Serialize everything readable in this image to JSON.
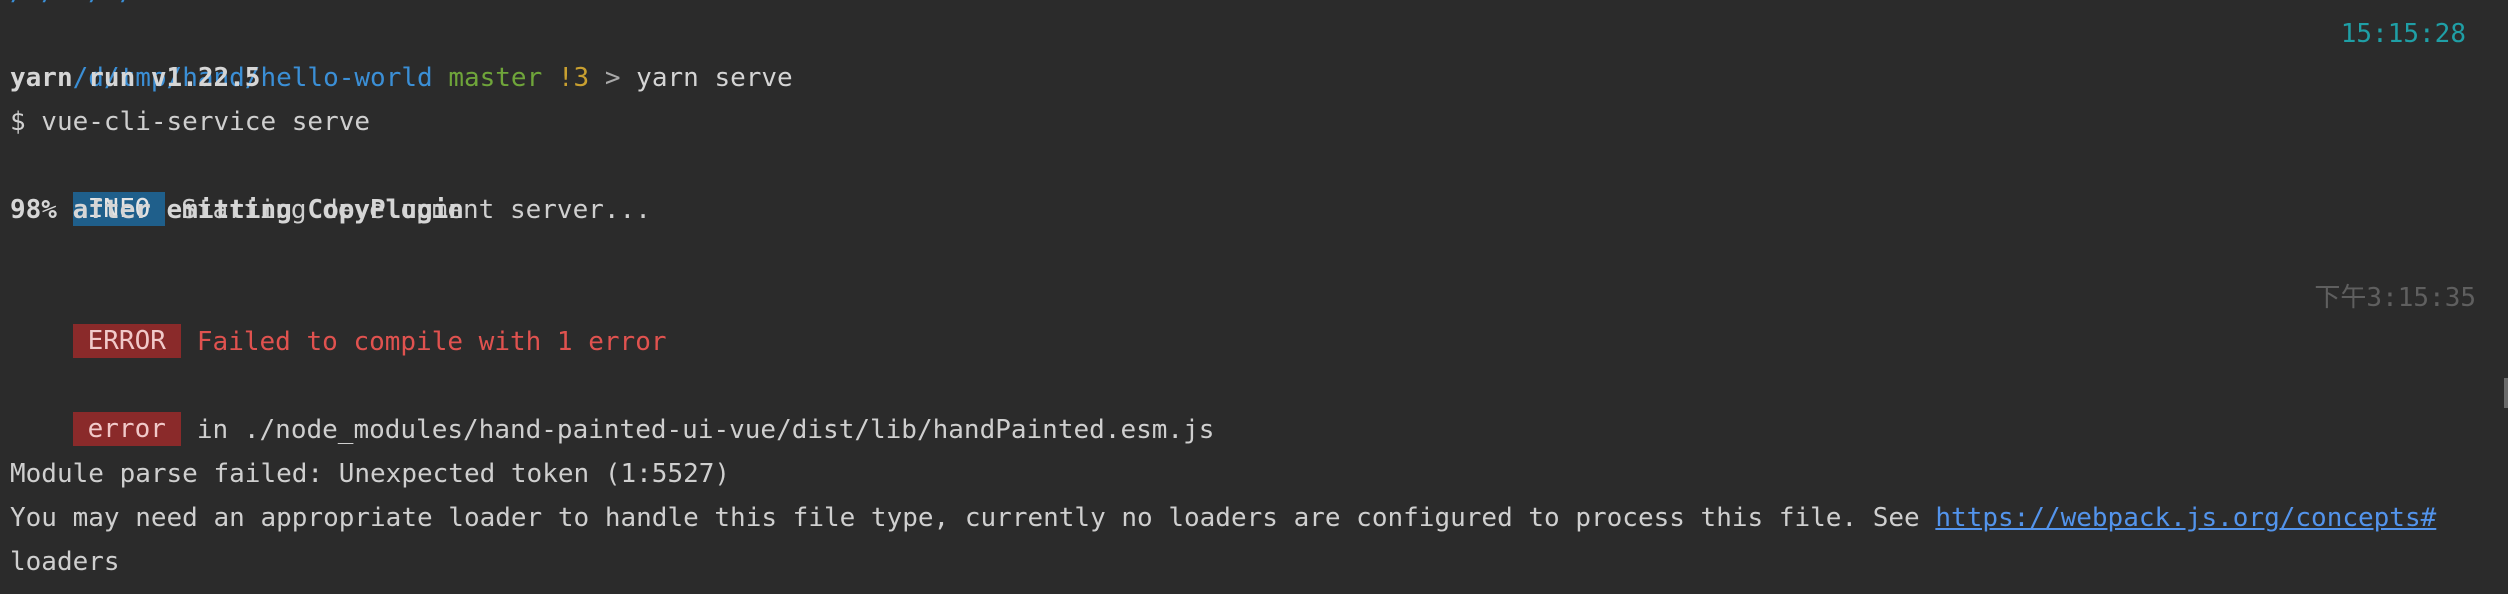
{
  "terminal": {
    "partial_line": "/ /  / / ",
    "prompt_line": {
      "path": "/d/tmp/hand/hello-world",
      "branch": "master",
      "status": "!3",
      "symbol": ">",
      "command": "yarn serve",
      "time": "15:15:28"
    },
    "yarn_version": "yarn run v1.22.5",
    "script_line": "$ vue-cli-service serve",
    "info": {
      "badge": "INFO",
      "text": "Starting development server..."
    },
    "progress_line": "98% after emitting CopyPlugin",
    "compile_error": {
      "badge": "ERROR",
      "text": "Failed to compile with 1 error",
      "time": "下午3:15:35"
    },
    "error_location": {
      "badge": "error",
      "text": "in ./node_modules/hand-painted-ui-vue/dist/lib/handPainted.esm.js"
    },
    "module_parse": "Module parse failed: Unexpected token (1:5527)",
    "loader_hint": {
      "text": "You may need an appropriate loader to handle this file type, currently no loaders are configured to process this file. See ",
      "link": "https://webpack.js.org/concepts#",
      "continuation": "loaders"
    }
  }
}
